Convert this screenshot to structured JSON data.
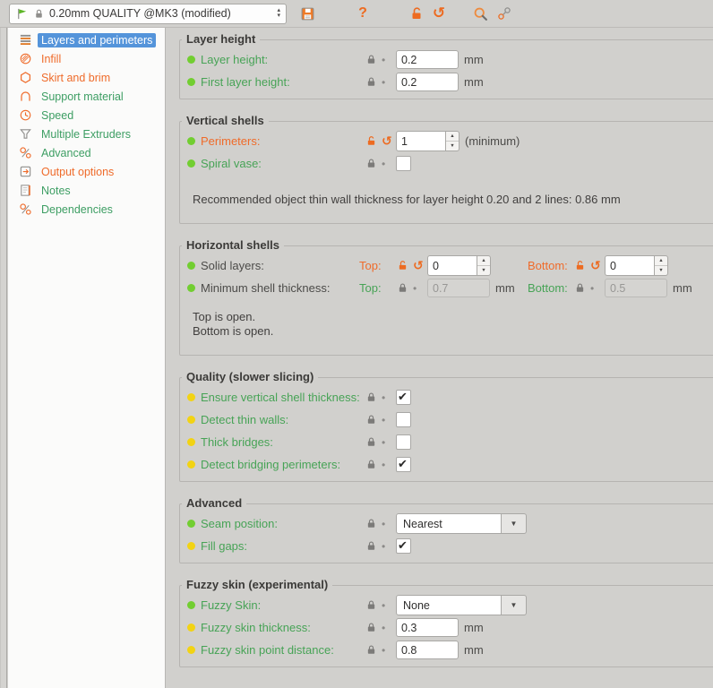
{
  "colors": {
    "accent_orange": "#ed6b21",
    "label_green": "#47a356",
    "selected_blue": "#5494da",
    "bullet_green": "#72ce31",
    "bullet_yellow": "#f2d313",
    "background": "#d1d0cd",
    "sidebar_bg": "#fbfbfa"
  },
  "icons": {
    "flag": "green-flag",
    "preset_lock": "padlock",
    "save": "floppy-disk",
    "help": "?",
    "unlock": "open-padlock",
    "undo": "↺",
    "search": "magnifier",
    "compare": "compare-circles",
    "row_lock": "padlock",
    "override_dot": "•",
    "dropdown_arrow": "▼",
    "check": "✔"
  },
  "toolbar": {
    "preset_value": "0.20mm QUALITY @MK3 (modified)"
  },
  "sidebar": {
    "items": [
      {
        "label": "Layers and perimeters",
        "color": "selected"
      },
      {
        "label": "Infill",
        "color": "orange"
      },
      {
        "label": "Skirt and brim",
        "color": "orange"
      },
      {
        "label": "Support material",
        "color": "green"
      },
      {
        "label": "Speed",
        "color": "green"
      },
      {
        "label": "Multiple Extruders",
        "color": "green"
      },
      {
        "label": "Advanced",
        "color": "green"
      },
      {
        "label": "Output options",
        "color": "orange"
      },
      {
        "label": "Notes",
        "color": "green"
      },
      {
        "label": "Dependencies",
        "color": "green"
      }
    ]
  },
  "sections": [
    {
      "title": "Layer height",
      "rows": [
        {
          "bullet": "green",
          "label": "Layer height:",
          "label_color": "green",
          "modified": false,
          "value": "0.2",
          "unit": "mm"
        },
        {
          "bullet": "green",
          "label": "First layer height:",
          "label_color": "green",
          "modified": false,
          "value": "0.2",
          "unit": "mm"
        }
      ]
    },
    {
      "title": "Vertical shells",
      "rows": [
        {
          "bullet": "green",
          "label": "Perimeters:",
          "label_color": "orange",
          "modified": true,
          "value": "1",
          "suffix": "(minimum)"
        },
        {
          "bullet": "green",
          "label": "Spiral vase:",
          "label_color": "green",
          "modified": false,
          "checked": false
        }
      ],
      "note": "Recommended object thin wall thickness for layer height 0.20 and 2 lines: 0.86 mm"
    },
    {
      "title": "Horizontal shells",
      "rows": [
        {
          "bullet": "green",
          "label": "Solid layers:",
          "label_color": "plain",
          "top": {
            "sublabel": "Top:",
            "color": "orange",
            "modified": true,
            "value": "0"
          },
          "bottom": {
            "sublabel": "Bottom:",
            "color": "orange",
            "modified": true,
            "value": "0"
          }
        },
        {
          "bullet": "green",
          "label": "Minimum shell thickness:",
          "label_color": "plain",
          "top": {
            "sublabel": "Top:",
            "color": "green",
            "modified": false,
            "value": "0.7",
            "unit": "mm"
          },
          "bottom": {
            "sublabel": "Bottom:",
            "color": "green",
            "modified": false,
            "value": "0.5",
            "unit": "mm"
          }
        }
      ],
      "notes": [
        "Top is open.",
        "Bottom is open."
      ]
    },
    {
      "title": "Quality (slower slicing)",
      "rows": [
        {
          "bullet": "yellow",
          "label": "Ensure vertical shell thickness:",
          "label_color": "green",
          "modified": false,
          "checked": true
        },
        {
          "bullet": "yellow",
          "label": "Detect thin walls:",
          "label_color": "green",
          "modified": false,
          "checked": false
        },
        {
          "bullet": "yellow",
          "label": "Thick bridges:",
          "label_color": "green",
          "modified": false,
          "checked": false
        },
        {
          "bullet": "yellow",
          "label": "Detect bridging perimeters:",
          "label_color": "green",
          "modified": false,
          "checked": true
        }
      ]
    },
    {
      "title": "Advanced",
      "rows": [
        {
          "bullet": "green",
          "label": "Seam position:",
          "label_color": "green",
          "modified": false,
          "value": "Nearest"
        },
        {
          "bullet": "yellow",
          "label": "Fill gaps:",
          "label_color": "green",
          "modified": false,
          "checked": true
        }
      ]
    },
    {
      "title": "Fuzzy skin (experimental)",
      "rows": [
        {
          "bullet": "green",
          "label": "Fuzzy Skin:",
          "label_color": "green",
          "modified": false,
          "value": "None"
        },
        {
          "bullet": "yellow",
          "label": "Fuzzy skin thickness:",
          "label_color": "green",
          "modified": false,
          "value": "0.3",
          "unit": "mm"
        },
        {
          "bullet": "yellow",
          "label": "Fuzzy skin point distance:",
          "label_color": "green",
          "modified": false,
          "value": "0.8",
          "unit": "mm"
        }
      ]
    }
  ]
}
